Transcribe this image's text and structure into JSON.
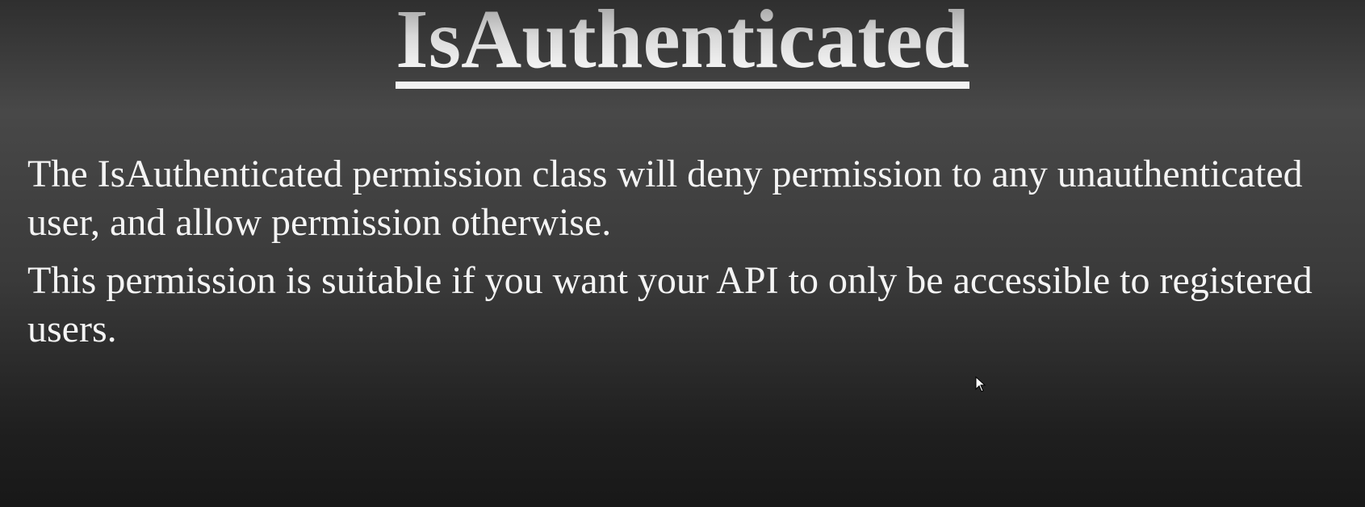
{
  "slide": {
    "title": "IsAuthenticated",
    "paragraphs": [
      "The IsAuthenticated permission class will deny permission to any unauthenticated user, and allow permission otherwise.",
      "This permission is suitable if you want your API to only be accessible to registered users."
    ]
  },
  "icons": {
    "cursor": "mouse-pointer-icon",
    "corner": "circle-control-icon"
  },
  "colors": {
    "background_top": "#484848",
    "background_bottom": "#181818",
    "text": "#f4f4f4",
    "title_highlight": "#ffffff"
  }
}
